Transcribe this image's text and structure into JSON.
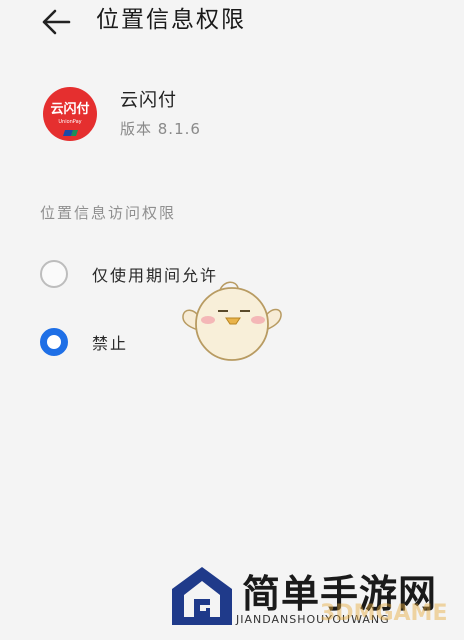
{
  "header": {
    "title": "位置信息权限",
    "back_icon": "arrow-left-icon"
  },
  "app": {
    "name": "云闪付",
    "version": "版本 8.1.6",
    "icon_text": "云闪付",
    "icon_subtext": "UnionPay",
    "icon_color": "#e52f2f"
  },
  "section": {
    "label": "位置信息访问权限"
  },
  "options": [
    {
      "label": "仅使用期间允许",
      "selected": false
    },
    {
      "label": "禁止",
      "selected": true
    }
  ],
  "colors": {
    "accent": "#1e6fe6",
    "background": "#f4f4f4"
  },
  "watermark": {
    "title": "简单手游网",
    "subtitle": "JIANDANSHOUYOUWANG",
    "overlay": "3DMGAME"
  }
}
